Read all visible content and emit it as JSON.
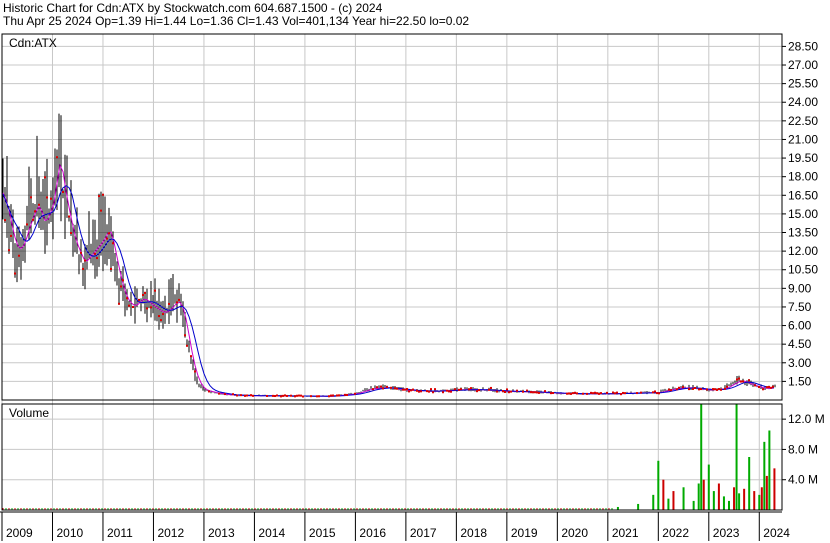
{
  "header": {
    "line1": "Historic Chart for Cdn:ATX by Stockwatch.com 604.687.1500 - (c) 2024",
    "line2": "Thu Apr 25 2024  Op=1.39  Hi=1.44  Lo=1.36  Cl=1.43  Vol=401,134  Year hi=22.50  lo=0.02"
  },
  "chart_data": [
    {
      "type": "line",
      "panel": "price",
      "title": "Cdn:ATX",
      "grid": true,
      "y_axis_side": "right",
      "ylim": [
        0,
        29.5
      ],
      "yticks": [
        1.5,
        3,
        4.5,
        6,
        7.5,
        9,
        10.5,
        12,
        13.5,
        15,
        16.5,
        18,
        19.5,
        21,
        22.5,
        24,
        25.5,
        27,
        28.5
      ],
      "ytick_labels": [
        "1.50",
        "3.00",
        "4.50",
        "6.00",
        "7.50",
        "9.00",
        "10.50",
        "12.00",
        "13.50",
        "15.00",
        "16.50",
        "18.00",
        "19.50",
        "21.00",
        "22.50",
        "24.00",
        "25.50",
        "27.00",
        "28.50"
      ],
      "xlim": [
        2009.0,
        2024.45
      ],
      "x_labels": [
        "2009",
        "2010",
        "2011",
        "2012",
        "2013",
        "2014",
        "2015",
        "2016",
        "2017",
        "2018",
        "2019",
        "2020",
        "2021",
        "2022",
        "2023",
        "2024"
      ],
      "colors": {
        "price_bars": "#000000",
        "close_dots": "#dd0000",
        "ma_short": "#cc00cc",
        "ma_long": "#0000cc"
      },
      "series": [
        {
          "x": [
            2009.0,
            2009.1,
            2009.2,
            2009.3,
            2009.4,
            2009.5,
            2009.6,
            2009.7,
            2009.8,
            2009.9,
            2010.0,
            2010.1,
            2010.2,
            2010.3,
            2010.4,
            2010.5,
            2010.6,
            2010.7,
            2010.8,
            2010.9,
            2011.0,
            2011.1,
            2011.2,
            2011.3,
            2011.4,
            2011.5,
            2011.6,
            2011.7,
            2011.8,
            2011.9,
            2012.0,
            2012.1,
            2012.2,
            2012.3,
            2012.4,
            2012.5,
            2012.6,
            2012.7,
            2012.8,
            2012.9,
            2013.0,
            2013.2,
            2013.4,
            2013.6,
            2013.8,
            2014.0,
            2014.5,
            2015.0,
            2015.5,
            2016.0,
            2016.3,
            2016.6,
            2017.0,
            2017.5,
            2018.0,
            2018.3,
            2018.6,
            2019.0,
            2019.5,
            2020.0,
            2020.5,
            2021.0,
            2021.5,
            2022.0,
            2022.3,
            2022.6,
            2023.0,
            2023.3,
            2023.6,
            2023.8,
            2024.0,
            2024.2,
            2024.3
          ],
          "values": [
            17,
            15,
            13,
            12,
            12.5,
            14,
            15,
            16,
            14,
            15,
            16,
            20,
            17,
            15,
            13,
            12,
            11,
            11.5,
            12,
            12.5,
            13,
            14,
            12,
            10,
            8.5,
            7.8,
            7.5,
            8,
            8.2,
            7.8,
            7.5,
            7.2,
            7.0,
            7.3,
            7.8,
            8.0,
            6.5,
            4.0,
            2.2,
            1.2,
            0.8,
            0.6,
            0.45,
            0.4,
            0.35,
            0.35,
            0.33,
            0.32,
            0.3,
            0.5,
            0.9,
            1.0,
            0.8,
            0.7,
            0.8,
            0.85,
            0.8,
            0.7,
            0.65,
            0.55,
            0.5,
            0.5,
            0.55,
            0.6,
            0.9,
            1.0,
            0.8,
            0.9,
            1.6,
            1.3,
            1.0,
            0.9,
            1.1
          ]
        }
      ]
    },
    {
      "type": "bar",
      "panel": "volume",
      "title": "Volume",
      "grid": true,
      "y_axis_side": "right",
      "ylim": [
        0,
        14000000
      ],
      "yticks": [
        4000000,
        8000000,
        12000000
      ],
      "ytick_labels": [
        "4.0 M",
        "8.0 M",
        "12.0 M"
      ],
      "colors": {
        "up": "#00aa00",
        "down": "#cc0000"
      },
      "series": [
        {
          "x": [
            2021.2,
            2021.6,
            2021.9,
            2022.0,
            2022.1,
            2022.2,
            2022.3,
            2022.5,
            2022.7,
            2022.8,
            2022.85,
            2022.9,
            2023.0,
            2023.1,
            2023.2,
            2023.3,
            2023.4,
            2023.5,
            2023.55,
            2023.6,
            2023.7,
            2023.8,
            2023.9,
            2024.0,
            2024.05,
            2024.1,
            2024.15,
            2024.2,
            2024.3
          ],
          "values": [
            400000,
            800000,
            2000000,
            6500000,
            4000000,
            1500000,
            2500000,
            3000000,
            1200000,
            3500000,
            14000000,
            4000000,
            6000000,
            2500000,
            3500000,
            1800000,
            1200000,
            3000000,
            14000000,
            2200000,
            2800000,
            7000000,
            2500000,
            2000000,
            3000000,
            9000000,
            4500000,
            10500000,
            5500000
          ],
          "up": [
            true,
            true,
            true,
            true,
            false,
            true,
            false,
            true,
            true,
            true,
            true,
            false,
            true,
            true,
            false,
            true,
            true,
            false,
            true,
            true,
            false,
            true,
            false,
            true,
            false,
            true,
            false,
            true,
            false
          ]
        }
      ]
    }
  ]
}
